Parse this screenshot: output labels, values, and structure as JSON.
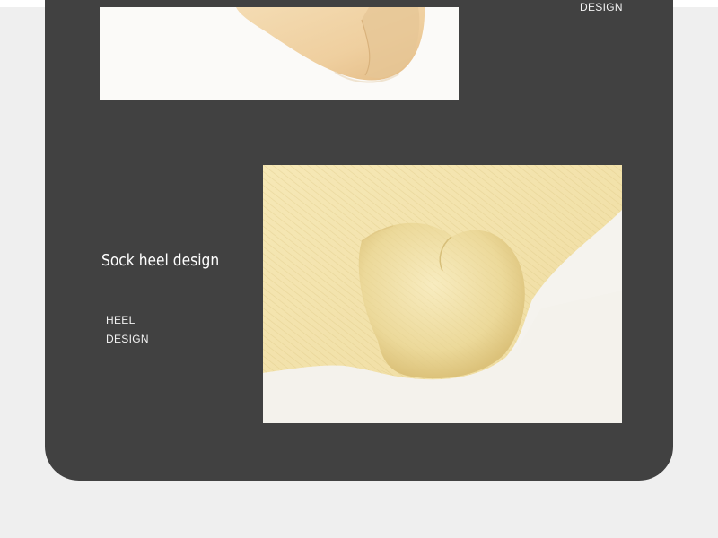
{
  "top_section": {
    "caption_word": "DESIGN"
  },
  "heel_section": {
    "title": "Sock heel design",
    "caption_line1": "HEEL",
    "caption_line2": "DESIGN"
  },
  "colors": {
    "page_background": "#efefef",
    "panel_background": "#414141",
    "text": "#ffffff",
    "sock_yellow": "#f2e2a6",
    "sock_beige": "#f0d3a4"
  }
}
